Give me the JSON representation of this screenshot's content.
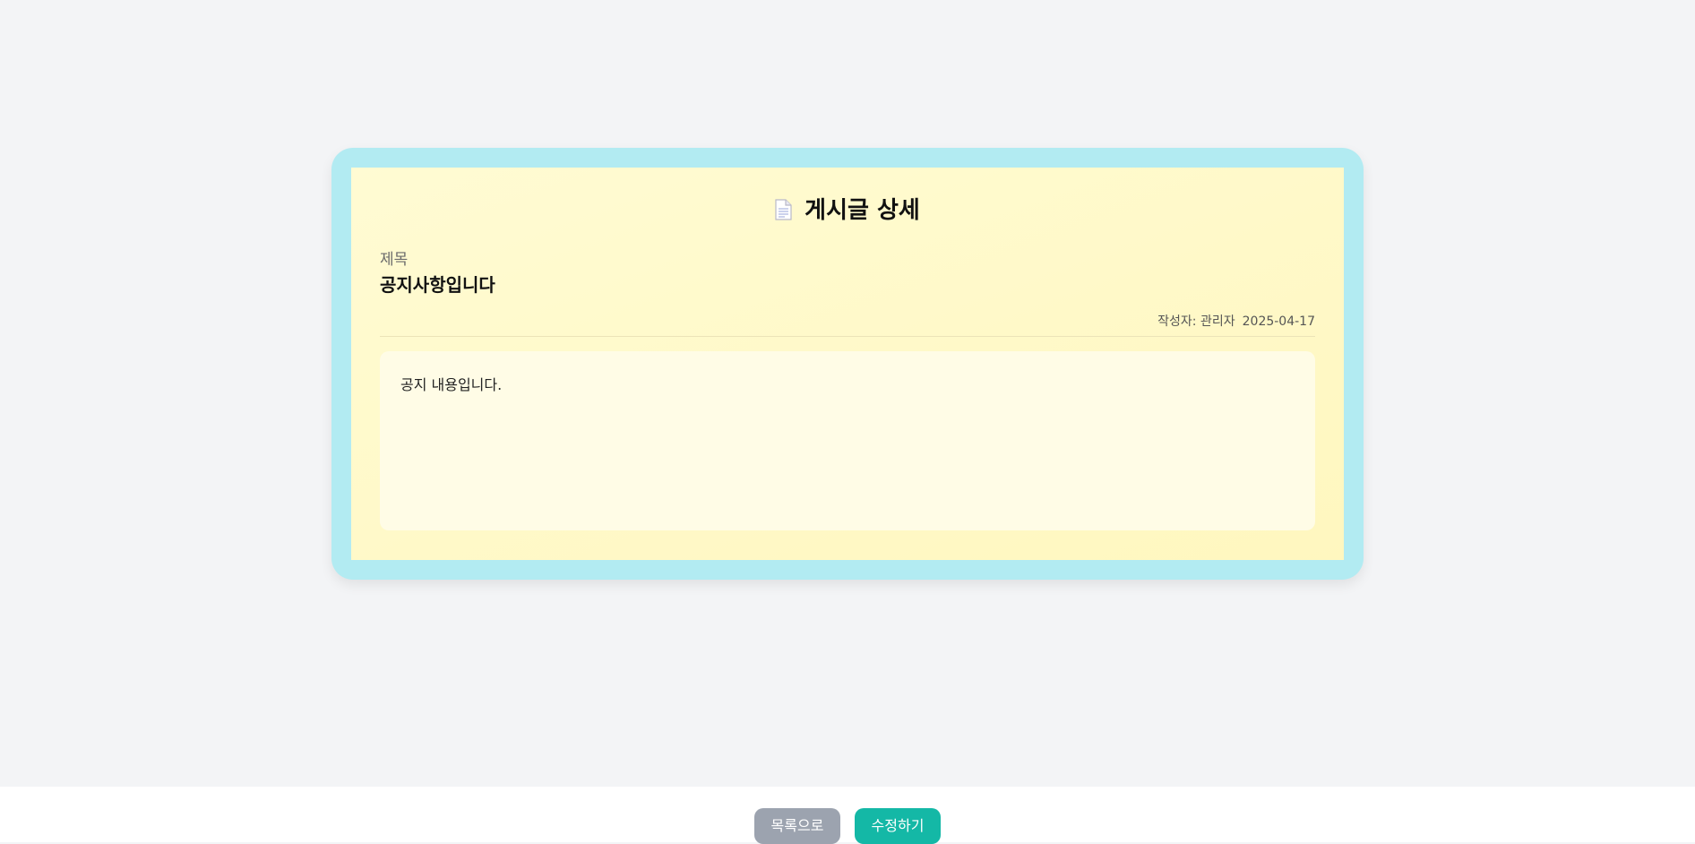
{
  "page": {
    "heading": "게시글 상세",
    "heading_icon": "document-icon"
  },
  "post": {
    "title_label": "제목",
    "title": "공지사항입니다",
    "author_text": "작성자: 관리자",
    "date": "2025-04-17",
    "content": "공지 내용입니다."
  },
  "actions": {
    "back_label": "목록으로",
    "edit_label": "수정하기"
  },
  "colors": {
    "page_bg": "#f3f4f6",
    "card_border": "#b2ebf2",
    "card_bg": "#fff7bf",
    "content_bg": "#fffce6",
    "back_button": "#9ca3af",
    "edit_button": "#14b8a6"
  }
}
